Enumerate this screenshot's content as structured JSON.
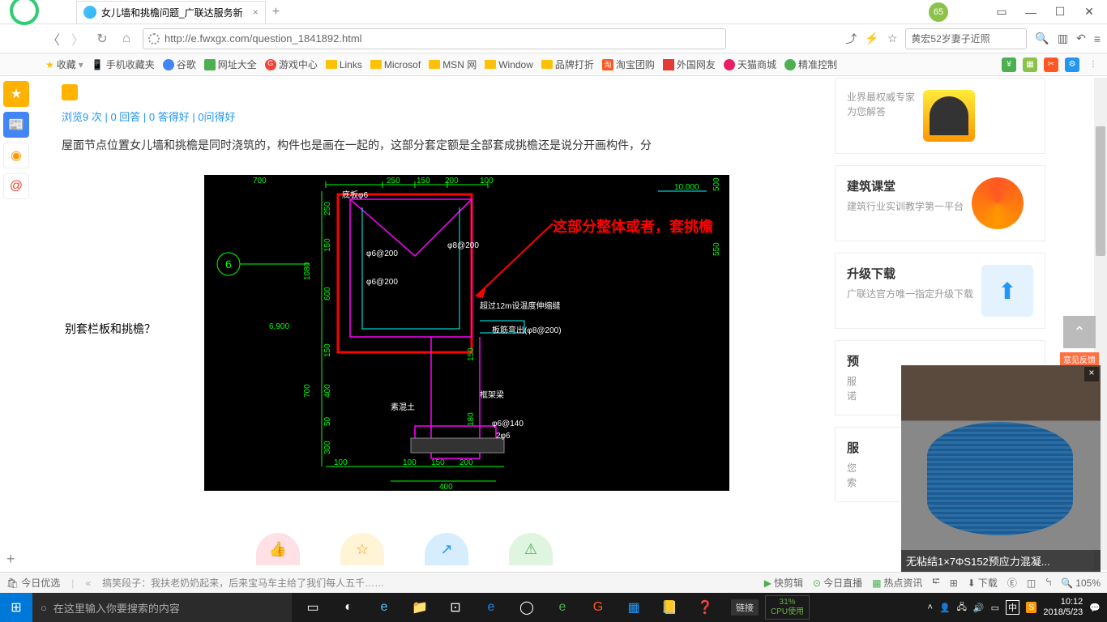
{
  "titlebar": {
    "tab_title": "女儿墙和挑檐问题_广联达服务新",
    "badge": "65"
  },
  "addr": {
    "url": "http://e.fwxgx.com/question_1841892.html",
    "search_placeholder": "黄宏52岁妻子近照"
  },
  "bookmarks": {
    "fav": "收藏",
    "items": [
      "手机收藏夹",
      "谷歌",
      "网址大全",
      "游戏中心",
      "Links",
      "Microsof",
      "MSN 网",
      "Window",
      "品牌打折",
      "淘宝团购",
      "外国网友",
      "天猫商城",
      "精准控制"
    ]
  },
  "question": {
    "stats": "浏览9 次 | 0 回答 | 0 答得好 | 0问得好",
    "body_top": "屋面节点位置女儿墙和挑檐是同时浇筑的，构件也是画在一起的，这部分套定额是全部套成挑檐还是说分开画构件，分",
    "body_left": "别套栏板和挑檐？",
    "annotation": "这部分整体或者，套挑檐"
  },
  "cad_dims": {
    "top": [
      "700",
      "250",
      "150",
      "200",
      "100",
      "500",
      "10.000"
    ],
    "left": [
      "250",
      "150",
      "1080",
      "600",
      "150",
      "700",
      "400",
      "50",
      "300"
    ],
    "bot": [
      "100",
      "100",
      "150",
      "200",
      "400",
      "150",
      "180"
    ],
    "labels": [
      "φ6@200",
      "φ6@200",
      "φ8@200",
      "6.900",
      "底板φ6",
      "框架梁",
      "素混土",
      "超过12m设温度伸缩缝",
      "板筋弯出(φ8@200)",
      "φ6@140",
      "2φ6",
      "550"
    ],
    "bubble": "6"
  },
  "cards": [
    {
      "title": "",
      "sub": "业界最权威专家\n为您解答"
    },
    {
      "title": "建筑课堂",
      "sub": "建筑行业实训教学第一平台"
    },
    {
      "title": "升级下载",
      "sub": "广联达官方唯一指定升级下载"
    },
    {
      "title": "预",
      "sub": "服\n诺"
    },
    {
      "title": "服",
      "sub": "您\n索"
    }
  ],
  "video": {
    "caption": "无粘结1×7ΦS152预应力混凝...",
    "tag": "意见反馈"
  },
  "status1": {
    "today": "今日优选",
    "news": "搞笑段子：我扶老奶奶起来，后来宝马车主给了我们每人五千……",
    "items": [
      "快剪辑",
      "今日直播",
      "热点资讯",
      "下载"
    ],
    "zoom": "105%",
    "sound": "ꕪ",
    "extras": [
      "⮓",
      "⊞",
      "Ⓔ"
    ]
  },
  "taskbar": {
    "search": "在这里输入你要搜索的内容",
    "cpu_pct": "31%",
    "cpu_lbl": "CPU使用",
    "links": "链接",
    "time": "10:12",
    "date": "2018/5/23",
    "ime": "中"
  }
}
